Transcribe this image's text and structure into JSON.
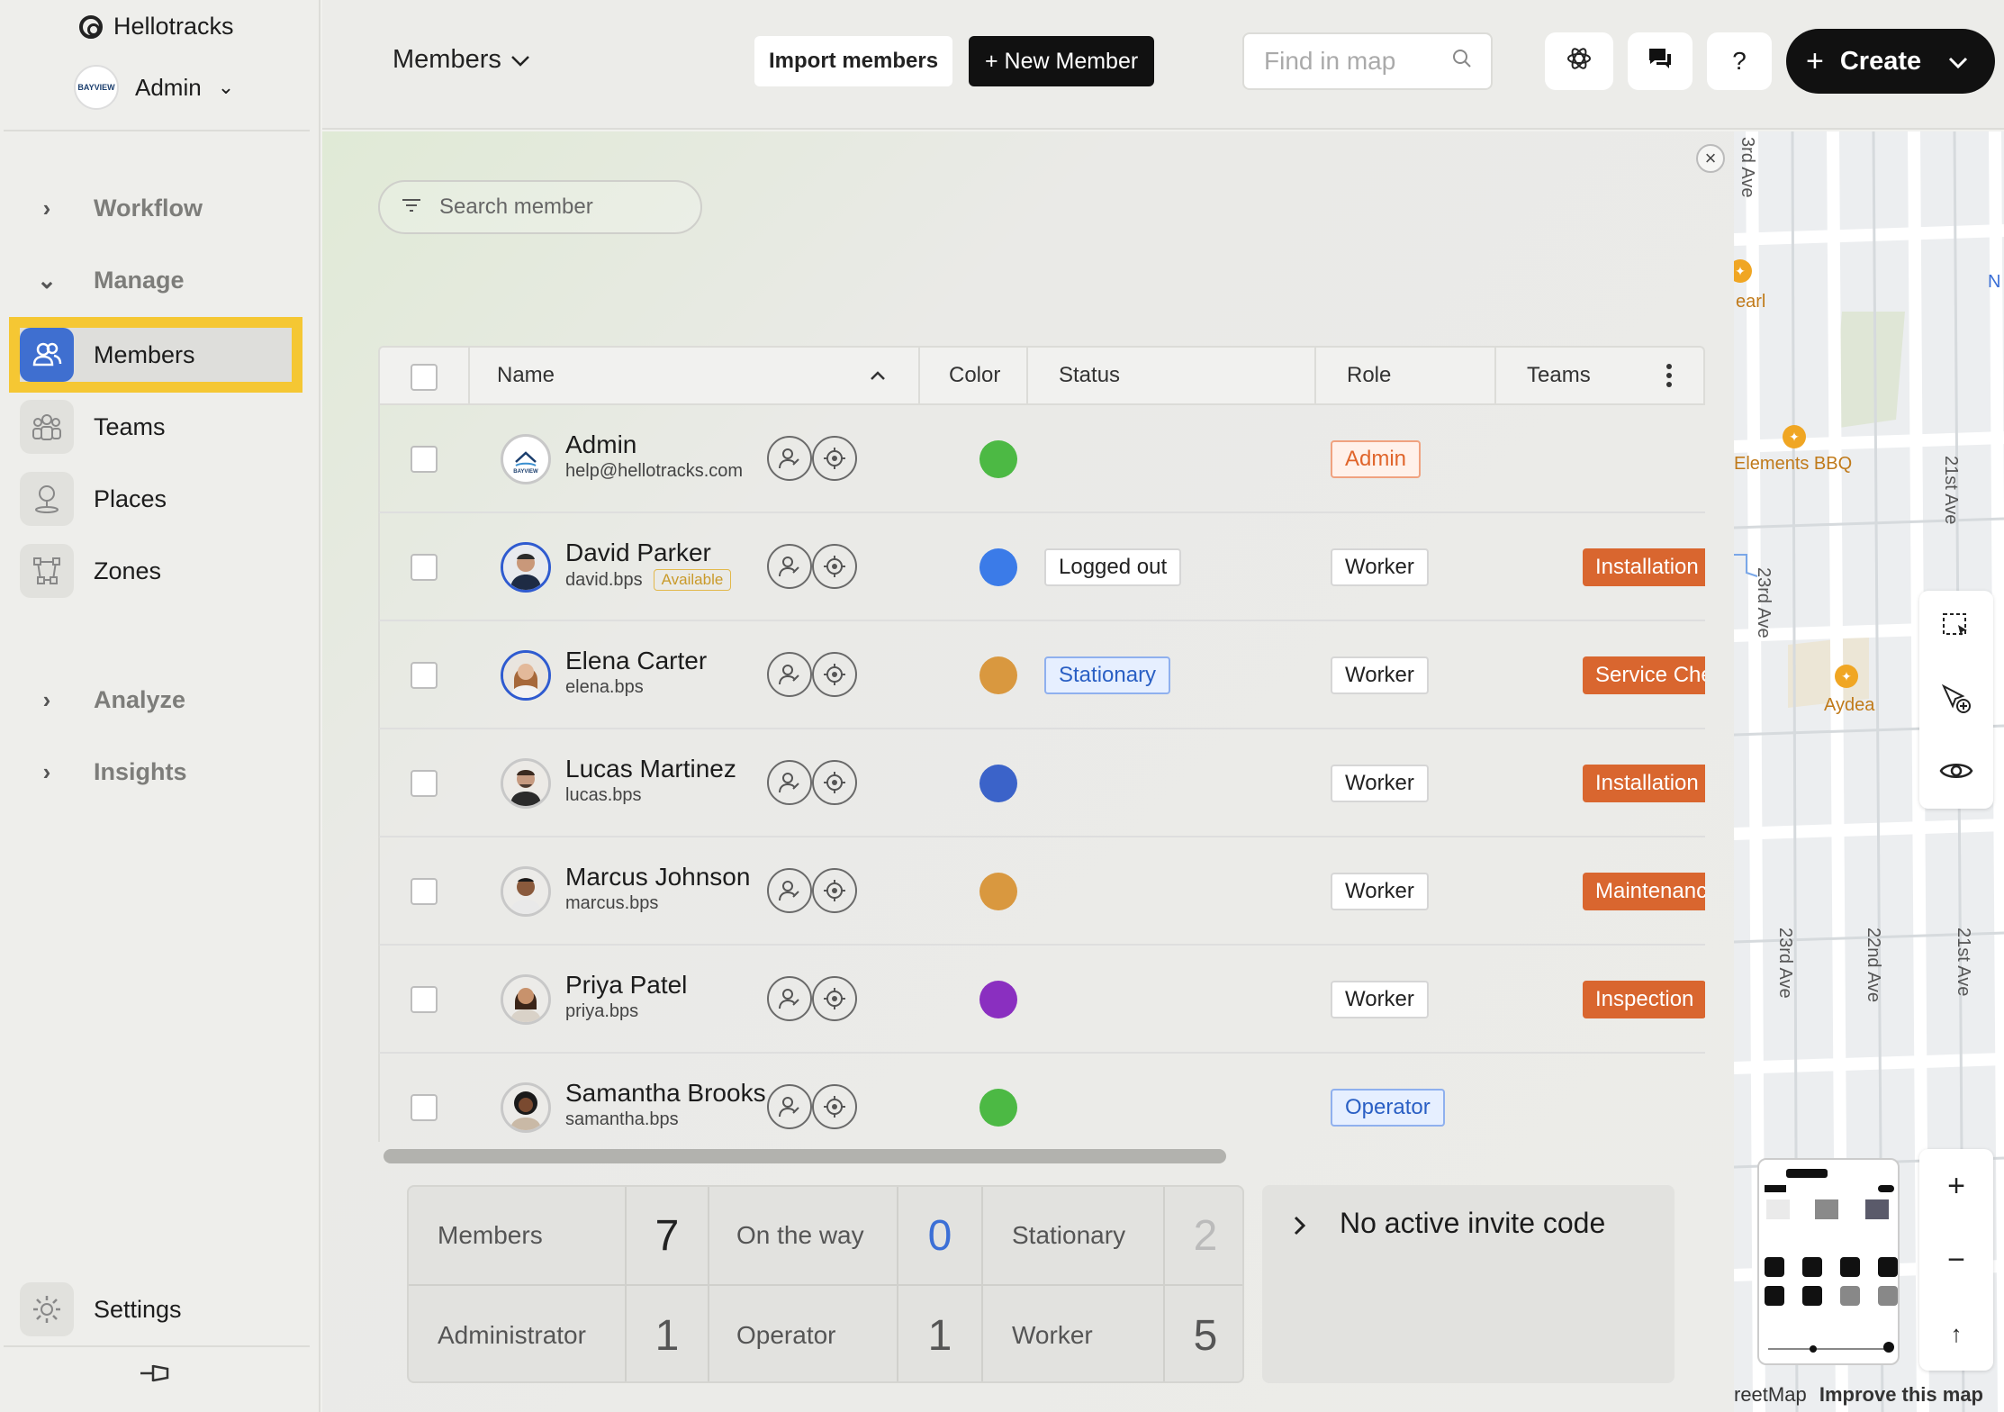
{
  "brand": {
    "name": "Hellotracks"
  },
  "account": {
    "name": "Admin",
    "logo_text": "BAYVIEW"
  },
  "sidebar": {
    "sections": [
      {
        "label": "Workflow",
        "expanded": false
      },
      {
        "label": "Manage",
        "expanded": true
      },
      {
        "label": "Analyze",
        "expanded": false
      },
      {
        "label": "Insights",
        "expanded": false
      }
    ],
    "items": [
      {
        "label": "Members",
        "icon": "users-icon",
        "active": true
      },
      {
        "label": "Teams",
        "icon": "team-icon"
      },
      {
        "label": "Places",
        "icon": "place-pin-icon"
      },
      {
        "label": "Zones",
        "icon": "zone-icon"
      }
    ],
    "settings_label": "Settings"
  },
  "topbar": {
    "page_selector": "Members",
    "import_label": "Import members",
    "new_member_label": "+ New Member",
    "find_placeholder": "Find in map",
    "help_label": "?",
    "create_label": "Create"
  },
  "members": {
    "search_placeholder": "Search member",
    "columns": [
      "Name",
      "Color",
      "Status",
      "Role",
      "Teams"
    ],
    "rows": [
      {
        "name": "Admin",
        "sub": "help@hellotracks.com",
        "badge": "",
        "color": "#4cb944",
        "status": "",
        "role": "Admin",
        "team": ""
      },
      {
        "name": "David Parker",
        "sub": "david.bps",
        "badge": "Available",
        "color": "#3b7be8",
        "status": "Logged out",
        "role": "Worker",
        "team": "Installation"
      },
      {
        "name": "Elena Carter",
        "sub": "elena.bps",
        "badge": "",
        "color": "#d9983f",
        "status": "Stationary",
        "role": "Worker",
        "team": "Service Checks"
      },
      {
        "name": "Lucas Martinez",
        "sub": "lucas.bps",
        "badge": "",
        "color": "#3b63c9",
        "status": "",
        "role": "Worker",
        "team": "Installation"
      },
      {
        "name": "Marcus Johnson",
        "sub": "marcus.bps",
        "badge": "",
        "color": "#d9983f",
        "status": "",
        "role": "Worker",
        "team": "Maintenance"
      },
      {
        "name": "Priya Patel",
        "sub": "priya.bps",
        "badge": "",
        "color": "#8a2fc0",
        "status": "",
        "role": "Worker",
        "team": "Inspection"
      },
      {
        "name": "Samantha Brooks",
        "sub": "samantha.bps",
        "badge": "",
        "color": "#4cb944",
        "status": "",
        "role": "Operator",
        "team": ""
      }
    ]
  },
  "stats": {
    "members_label": "Members",
    "members_value": "7",
    "ontheway_label": "On the way",
    "ontheway_value": "0",
    "stationary_label": "Stationary",
    "stationary_value": "2",
    "administrator_label": "Administrator",
    "administrator_value": "1",
    "operator_label": "Operator",
    "operator_value": "1",
    "worker_label": "Worker",
    "worker_value": "5"
  },
  "invite": {
    "label": "No active invite code"
  },
  "map": {
    "labels": [
      "3rd Ave",
      "earl",
      "Elements BBQ",
      "21st Ave",
      "23rd Ave",
      "Aydea",
      "23rd Ave",
      "22nd Ave",
      "21st Ave",
      "N"
    ],
    "attribution": "reetMap",
    "improve_label": "Improve this map",
    "zoom_in": "+",
    "zoom_out": "−",
    "north": "↑"
  }
}
